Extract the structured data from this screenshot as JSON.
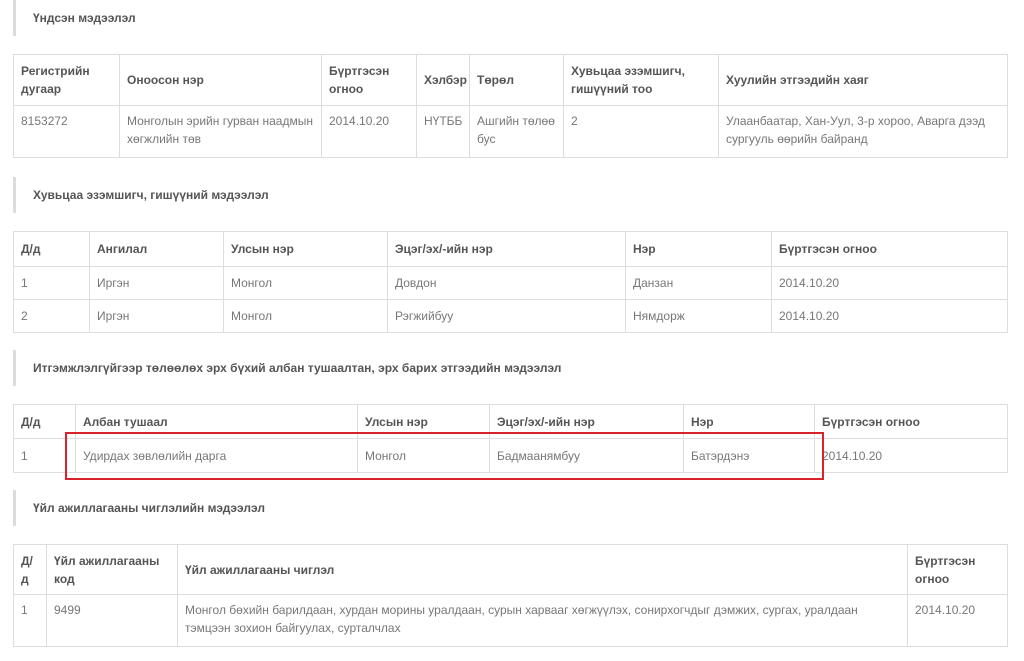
{
  "section1": {
    "title": "Үндсэн мэдээлэл",
    "headers": [
      "Регистрийн дугаар",
      "Оноосон нэр",
      "Бүртгэсэн огноо",
      "Хэлбэр",
      "Төрөл",
      "Хувьцаа эзэмшигч, гишүүний тоо",
      "Хуулийн этгээдийн хаяг"
    ],
    "row": [
      "8153272",
      "Монголын эрийн гурван наадмын хөгжлийн төв",
      "2014.10.20",
      "НҮТББ",
      "Ашгийн төлөө бус",
      "2",
      "Улаанбаатар, Хан-Уул, 3-р хороо, Аварга дээд сургууль өөрийн байранд"
    ]
  },
  "section2": {
    "title": "Хувьцаа эзэмшигч, гишүүний мэдээлэл",
    "headers": [
      "Д/д",
      "Ангилал",
      "Улсын нэр",
      "Эцэг/эх/-ийн нэр",
      "Нэр",
      "Бүртгэсэн огноо"
    ],
    "rows": [
      [
        "1",
        "Иргэн",
        "Монгол",
        "Довдон",
        "Данзан",
        "2014.10.20"
      ],
      [
        "2",
        "Иргэн",
        "Монгол",
        "Рэгжийбуу",
        "Нямдорж",
        "2014.10.20"
      ]
    ]
  },
  "section3": {
    "title": "Итгэмжлэлгүйгээр төлөөлөх эрх бүхий албан тушаалтан, эрх барих этгээдийн мэдээлэл",
    "headers": [
      "Д/д",
      "Албан тушаал",
      "Улсын нэр",
      "Эцэг/эх/-ийн нэр",
      "Нэр",
      "Бүртгэсэн огноо"
    ],
    "rows": [
      [
        "1",
        "Удирдах зөвлөлийн дарга",
        "Монгол",
        "Бадмаанямбуу",
        "Батэрдэнэ",
        "2014.10.20"
      ]
    ]
  },
  "section4": {
    "title": "Үйл ажиллагааны чиглэлийн мэдээлэл",
    "headers": [
      "Д/д",
      "Үйл ажиллагааны код",
      "Үйл ажиллагааны чиглэл",
      "Бүртгэсэн огноо"
    ],
    "rows": [
      [
        "1",
        "9499",
        "Монгол бөхийн барилдаан, хурдан морины уралдаан, сурын харвааг хөгжүүлэх, сонирхогчдыг дэмжих, сургах, уралдаан тэмцээн зохион байгуулах, сурталчлах",
        "2014.10.20"
      ]
    ]
  },
  "highlight_color": "#d9222a"
}
